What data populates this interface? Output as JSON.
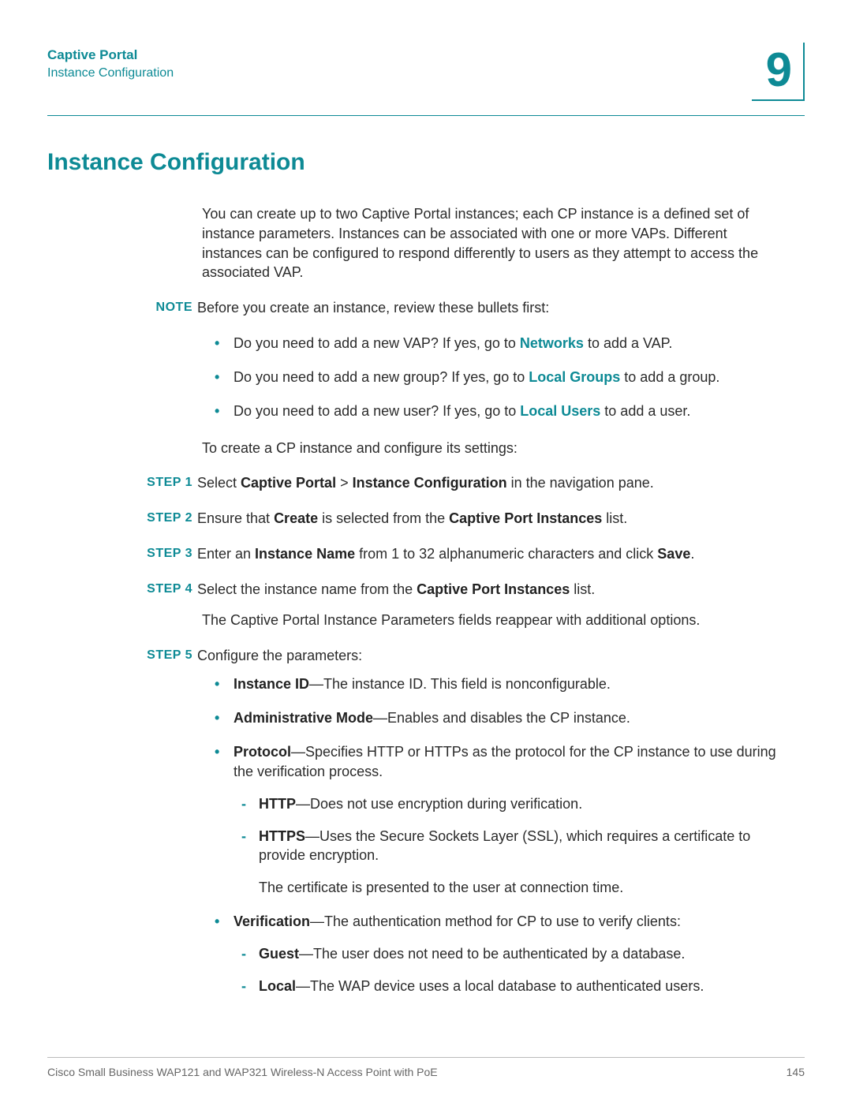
{
  "header": {
    "chapter_title": "Captive Portal",
    "section_sub": "Instance Configuration",
    "chapter_number": "9"
  },
  "main_heading": "Instance Configuration",
  "intro": "You can create up to two Captive Portal instances; each CP instance is a defined set of instance parameters. Instances can be associated with one or more VAPs. Different instances can be configured to respond differently to users as they attempt to access the associated VAP.",
  "note_label": "NOTE",
  "note_text": "Before you create an instance, review these bullets first:",
  "note_bullets": {
    "b1_pre": "Do you need to add a new VAP? If yes, go to ",
    "b1_link": "Networks",
    "b1_post": " to add a VAP.",
    "b2_pre": "Do you need to add a new group? If yes, go to ",
    "b2_link": "Local Groups",
    "b2_post": " to add a group.",
    "b3_pre": "Do you need to add a new user? If yes, go to ",
    "b3_link": "Local Users",
    "b3_post": " to add a user."
  },
  "create_intro": "To create a CP instance and configure its settings:",
  "steps": {
    "s1_label": "STEP  1",
    "s1_a": "Select ",
    "s1_b1": "Captive Portal",
    "s1_gt": " > ",
    "s1_b2": "Instance Configuration",
    "s1_c": " in the navigation pane.",
    "s2_label": "STEP  2",
    "s2_a": "Ensure that ",
    "s2_b1": "Create",
    "s2_b": " is selected from the ",
    "s2_b2": "Captive Port Instances",
    "s2_c": " list.",
    "s3_label": "STEP  3",
    "s3_a": "Enter an ",
    "s3_b1": "Instance Name",
    "s3_b": " from 1 to 32 alphanumeric characters and click ",
    "s3_b2": "Save",
    "s3_c": ".",
    "s4_label": "STEP  4",
    "s4_a": "Select the instance name from the ",
    "s4_b1": "Captive Port Instances",
    "s4_b": " list.",
    "s4_extra": "The Captive Portal Instance Parameters fields reappear with additional options.",
    "s5_label": "STEP  5",
    "s5_a": "Configure the parameters:"
  },
  "params": {
    "p1_b": "Instance ID",
    "p1_t": "—The instance ID. This field is nonconfigurable.",
    "p2_b": "Administrative Mode",
    "p2_t": "—Enables and disables the CP instance.",
    "p3_b": "Protocol",
    "p3_t": "—Specifies HTTP or HTTPs as the protocol for the CP instance to use during the verification process.",
    "p3_d1_b": "HTTP",
    "p3_d1_t": "—Does not use encryption during verification.",
    "p3_d2_b": "HTTPS",
    "p3_d2_t": "—Uses the Secure Sockets Layer (SSL), which requires a certificate to provide encryption.",
    "p3_cert": "The certificate is presented to the user at connection time.",
    "p4_b": "Verification",
    "p4_t": "—The authentication method for CP to use to verify clients:",
    "p4_d1_b": "Guest",
    "p4_d1_t": "—The user does not need to be authenticated by a database.",
    "p4_d2_b": "Local",
    "p4_d2_t": "—The WAP device uses a local database to authenticated users."
  },
  "footer": {
    "left": "Cisco Small Business WAP121 and WAP321 Wireless-N Access Point with PoE",
    "right": "145"
  }
}
